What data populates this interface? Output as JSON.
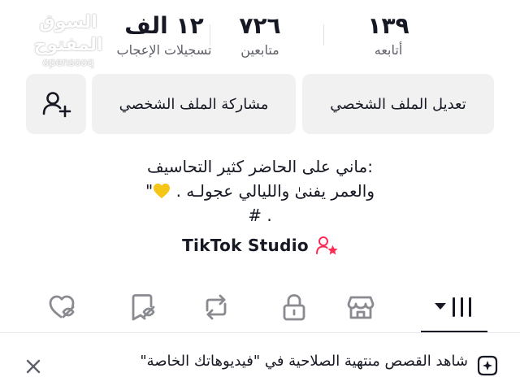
{
  "stats": {
    "likes": {
      "value": "١٢ الف",
      "label": "تسجيلات الإعجاب"
    },
    "followers": {
      "value": "٧٢٦",
      "label": "متابعين"
    },
    "following": {
      "value": "١٣٩",
      "label": "أتابعه"
    }
  },
  "watermark": {
    "line1": "السوق المفتوح",
    "line2": "opensooq"
  },
  "actions": {
    "edit_profile": "تعديل الملف الشخصي",
    "share_profile": "مشاركة الملف الشخصي",
    "add_friend_icon": "add-user-icon"
  },
  "bio": {
    "line1": ":ماني على الحاضر كثير التحاسيف",
    "line2": "والعمر يفنىٰ والليالي عجولـه .",
    "line2_end": "\"",
    "line3": "# .",
    "heart_color": "#f5c518"
  },
  "studio": {
    "label": "TikTok Studio",
    "icon": "creator-user-icon",
    "accent": "#fe2c55"
  },
  "tabs": [
    {
      "name": "videos",
      "icon": "grid-menu-icon",
      "active": true
    },
    {
      "name": "shop",
      "icon": "store-icon",
      "active": false
    },
    {
      "name": "private",
      "icon": "lock-icon",
      "active": false
    },
    {
      "name": "reposts",
      "icon": "repost-icon",
      "active": false
    },
    {
      "name": "favorites",
      "icon": "bookmark-hidden-icon",
      "active": false
    },
    {
      "name": "liked",
      "icon": "heart-hidden-icon",
      "active": false
    }
  ],
  "banner": {
    "text": "شاهد القصص منتهية الصلاحية في \"فيديوهاتك الخاصة\"",
    "icon": "story-sparkle-icon",
    "close_icon": "close-icon"
  }
}
